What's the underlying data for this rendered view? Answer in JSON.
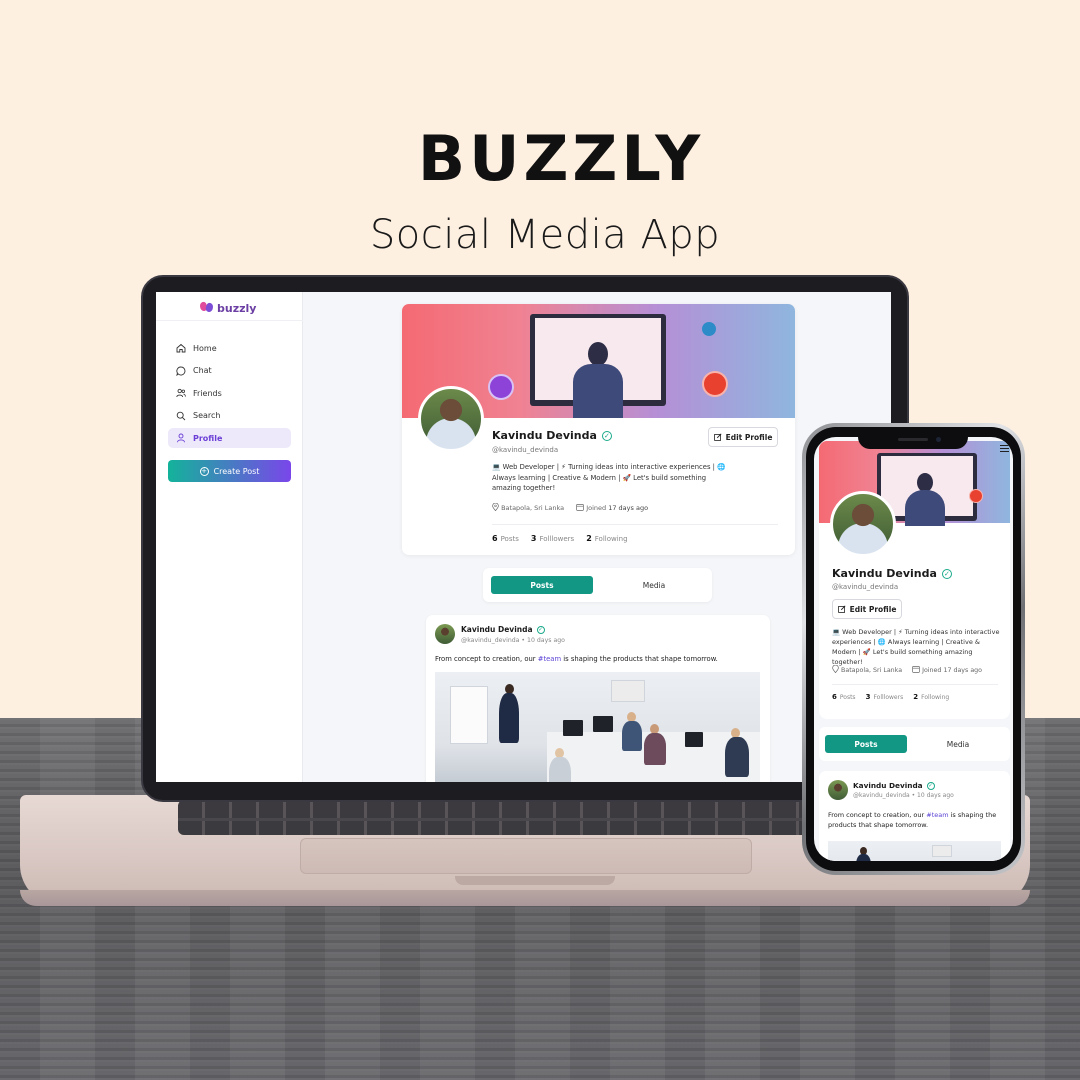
{
  "hero": {
    "title": "BUZZLY",
    "subtitle": "Social Media App"
  },
  "brand": {
    "logo_text": "buzzly",
    "accent": "#6b3fd6",
    "teal": "#119784"
  },
  "sidebar": {
    "items": [
      {
        "label": "Home",
        "icon": "home-icon",
        "active": false
      },
      {
        "label": "Chat",
        "icon": "chat-icon",
        "active": false
      },
      {
        "label": "Friends",
        "icon": "friends-icon",
        "active": false
      },
      {
        "label": "Search",
        "icon": "search-icon",
        "active": false
      },
      {
        "label": "Profile",
        "icon": "user-icon",
        "active": true
      }
    ],
    "create_post": "Create Post"
  },
  "profile": {
    "name": "Kavindu Devinda",
    "handle": "@kavindu_devinda",
    "edit_label": "Edit Profile",
    "bio": "💻 Web Developer | ⚡ Turning ideas into interactive experiences | 🌐 Always learning | Creative & Modern | 🚀 Let's build something amazing together!",
    "location": "Batapola, Sri Lanka",
    "joined": "Joined",
    "joined_when": "17 days ago",
    "stats": {
      "posts_count": "6",
      "posts_label": "Posts",
      "followers_count": "3",
      "followers_label": "Folllowers",
      "following_count": "2",
      "following_label": "Following"
    }
  },
  "tabs": {
    "posts": "Posts",
    "media": "Media"
  },
  "post": {
    "author": "Kavindu Devinda",
    "sub": "@kavindu_devinda • 10 days ago",
    "text_before": "From concept to creation, our ",
    "hashtag": "#team",
    "text_after": " is shaping the products that shape tomorrow."
  }
}
